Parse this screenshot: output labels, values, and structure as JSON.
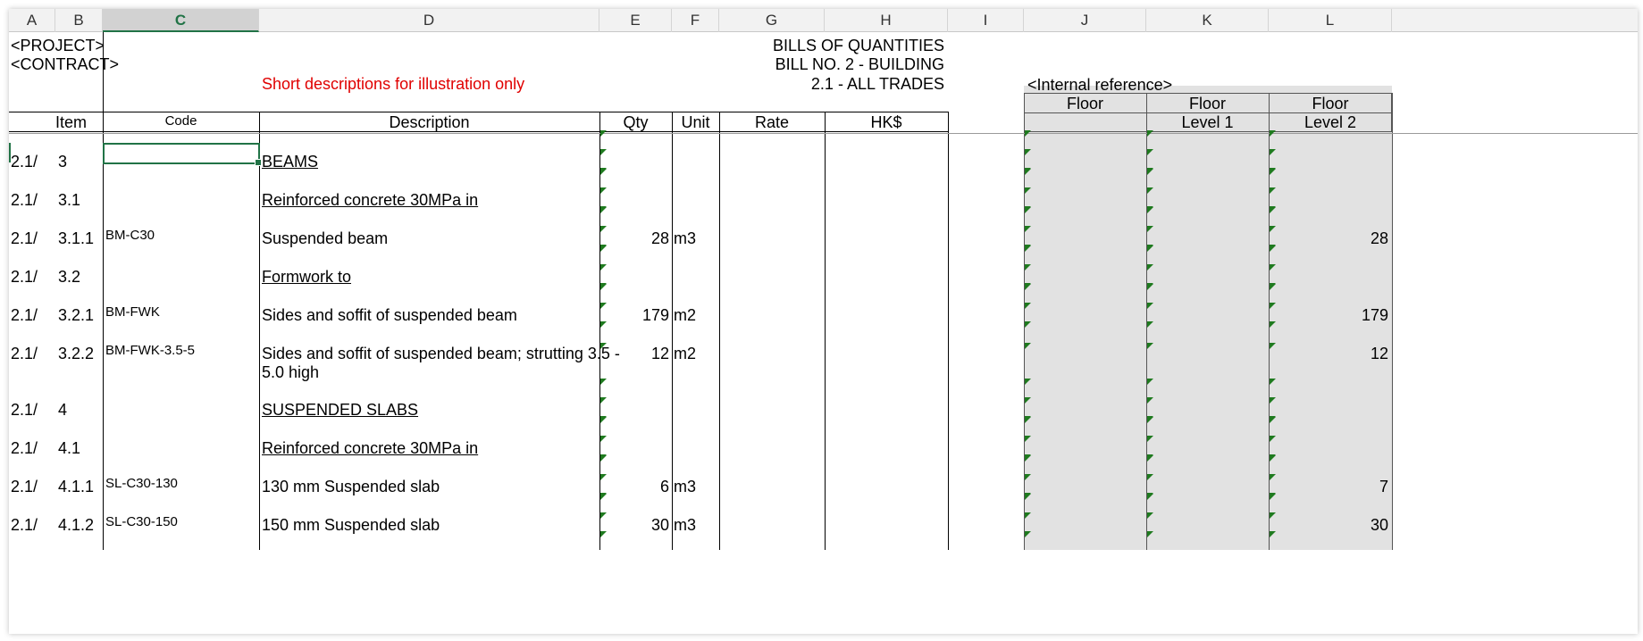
{
  "columns": [
    "A",
    "B",
    "C",
    "D",
    "E",
    "F",
    "G",
    "H",
    "I",
    "J",
    "K",
    "L"
  ],
  "selected_column": "C",
  "header": {
    "project": "<PROJECT>",
    "contract": "<CONTRACT>",
    "note": "Short descriptions for illustration only",
    "title1": "BILLS OF QUANTITIES",
    "title2": "BILL NO. 2 - BUILDING",
    "title3": "2.1 - ALL TRADES",
    "internal_ref": "<Internal reference>"
  },
  "table_header": {
    "item": "Item",
    "code": "Code",
    "description": "Description",
    "qty": "Qty",
    "unit": "Unit",
    "rate": "Rate",
    "amount": "HK$",
    "floor_j": "Floor",
    "floor_k": "Floor",
    "floor_l": "Floor",
    "level_k": "Level 1",
    "level_l": "Level 2"
  },
  "rows": [
    {
      "a": "2.1/",
      "b": "3",
      "c": "",
      "d": "BEAMS",
      "d_underline": true,
      "e": "",
      "f": "",
      "l": ""
    },
    {
      "a": "2.1/",
      "b": "3.1",
      "c": "",
      "d": "Reinforced concrete 30MPa in",
      "d_underline": true,
      "e": "",
      "f": "",
      "l": ""
    },
    {
      "a": "2.1/",
      "b": "3.1.1",
      "c": "BM-C30",
      "d": "Suspended beam",
      "d_underline": false,
      "e": "28",
      "f": "m3",
      "l": "28"
    },
    {
      "a": "2.1/",
      "b": "3.2",
      "c": "",
      "d": "Formwork to",
      "d_underline": true,
      "e": "",
      "f": "",
      "l": ""
    },
    {
      "a": "2.1/",
      "b": "3.2.1",
      "c": "BM-FWK",
      "d": "Sides and soffit of suspended beam",
      "d_underline": false,
      "e": "179",
      "f": "m2",
      "l": "179"
    },
    {
      "a": "2.1/",
      "b": "3.2.2",
      "c": "BM-FWK-3.5-5",
      "d": "Sides and soffit of suspended beam; strutting 3.5 -",
      "d2": "5.0 high",
      "d_underline": false,
      "e": "12",
      "f": "m2",
      "l": "12"
    },
    {
      "a": "2.1/",
      "b": "4",
      "c": "",
      "d": "SUSPENDED SLABS",
      "d_underline": true,
      "e": "",
      "f": "",
      "l": ""
    },
    {
      "a": "2.1/",
      "b": "4.1",
      "c": "",
      "d": "Reinforced concrete 30MPa in",
      "d_underline": true,
      "e": "",
      "f": "",
      "l": ""
    },
    {
      "a": "2.1/",
      "b": "4.1.1",
      "c": "SL-C30-130",
      "d": "130 mm Suspended slab",
      "d_underline": false,
      "e": "6",
      "f": "m3",
      "l": "7"
    },
    {
      "a": "2.1/",
      "b": "4.1.2",
      "c": "SL-C30-150",
      "d": "150 mm Suspended slab",
      "d_underline": false,
      "e": "30",
      "f": "m3",
      "l": "30"
    }
  ],
  "colors": {
    "selection": "#217346",
    "gray_fill": "#e2e2e2",
    "note_red": "#e00000",
    "triangle": "#1f7a1f"
  }
}
